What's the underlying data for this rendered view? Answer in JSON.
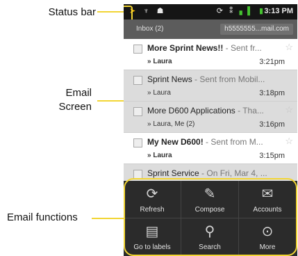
{
  "callouts": {
    "status_bar": "Status bar",
    "email_screen_1": "Email",
    "email_screen_2": "Screen",
    "email_functions": "Email functions"
  },
  "status_bar": {
    "time": "3:13 PM"
  },
  "inbox": {
    "label": "Inbox (2)",
    "account": "h5555555...mail.com"
  },
  "emails": [
    {
      "subject": "More Sprint News!!",
      "snippet": " - Sent fr...",
      "from": "» Laura",
      "date": "3:21pm",
      "unread": true
    },
    {
      "subject": "Sprint News",
      "snippet": " - Sent from Mobil...",
      "from": "» Laura",
      "date": "3:18pm",
      "unread": false
    },
    {
      "subject": "More D600 Applications",
      "snippet": " - Tha...",
      "from": "» Laura, Me (2)",
      "date": "3:16pm",
      "unread": false
    },
    {
      "subject": "My New D600!",
      "snippet": " - Sent from M...",
      "from": "» Laura",
      "date": "3:15pm",
      "unread": true
    },
    {
      "subject": "Sprint Service",
      "snippet": " - On Fri, Mar 4, ...",
      "from": "",
      "date": "",
      "unread": false
    }
  ],
  "menu": [
    {
      "label": "Refresh",
      "icon": "refresh-icon"
    },
    {
      "label": "Compose",
      "icon": "compose-icon"
    },
    {
      "label": "Accounts",
      "icon": "accounts-icon"
    },
    {
      "label": "Go to labels",
      "icon": "labels-icon"
    },
    {
      "label": "Search",
      "icon": "search-icon"
    },
    {
      "label": "More",
      "icon": "more-icon"
    }
  ],
  "colors": {
    "highlight": "#f2d534",
    "status_bar_bg": "#151515",
    "menu_bg": "#2b2b2b",
    "inbox_bar_bg": "#5c5c5c"
  }
}
